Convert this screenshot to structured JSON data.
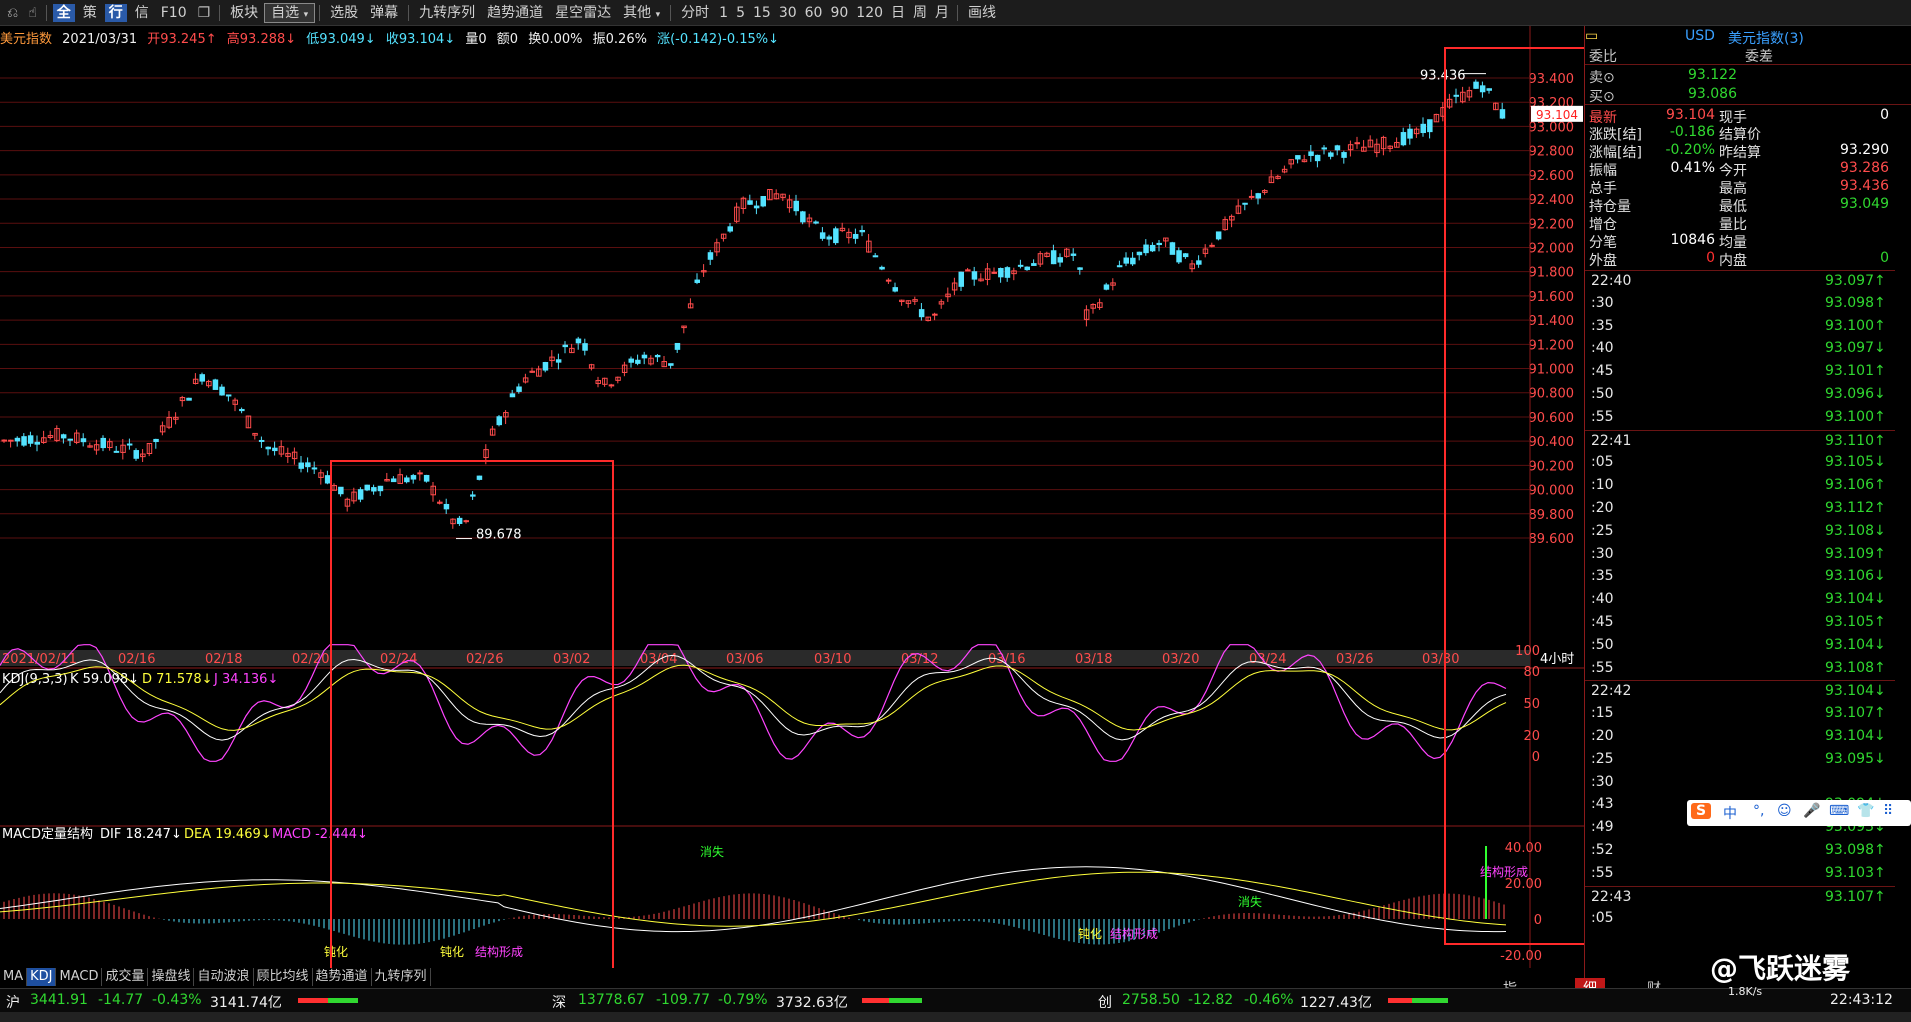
{
  "toolbar": {
    "icons": [
      "back-icon",
      "hand-icon"
    ],
    "items": [
      "全",
      "策",
      "行",
      "信",
      "F10",
      "板块",
      "自选",
      "选股",
      "弹幕",
      "九转序列",
      "趋势通道",
      "星空雷达",
      "其他",
      "分时",
      "1",
      "5",
      "15",
      "30",
      "60",
      "90",
      "120",
      "日",
      "周",
      "月",
      "画线"
    ]
  },
  "info": {
    "name": "美元指数",
    "date": "2021/03/31",
    "open": "开93.245↑",
    "high": "高93.288↓",
    "low": "低93.049↓",
    "close": "收93.104↓",
    "vol": "量0",
    "amount": "额0",
    "turnover": "换0.00%",
    "amplitude": "振0.26%",
    "change": "涨(-0.142)-0.15%↓"
  },
  "main_chart": {
    "price_labels": [
      "93.400",
      "93.200",
      "93.000",
      "92.800",
      "92.600",
      "92.400",
      "92.200",
      "92.000",
      "91.800",
      "91.600",
      "91.400",
      "91.200",
      "91.000",
      "90.800",
      "90.600",
      "90.400",
      "90.200",
      "90.000",
      "89.800",
      "89.600"
    ],
    "price_values": [
      93.4,
      93.2,
      93.0,
      92.8,
      92.6,
      92.4,
      92.2,
      92.0,
      91.8,
      91.6,
      91.4,
      91.2,
      91.0,
      90.8,
      90.6,
      90.4,
      90.2,
      90.0,
      89.8,
      89.6
    ],
    "current_price_tag": "93.104",
    "high_annotation": "93.436",
    "low_annotation": "89.678",
    "date_labels": [
      "2021/02/11",
      "02/16",
      "02/18",
      "02/20",
      "02/24",
      "02/26",
      "03/02",
      "03/04",
      "03/06",
      "03/10",
      "03/12",
      "03/16",
      "03/18",
      "03/20",
      "03/24",
      "03/26",
      "03/30"
    ],
    "period_label": "4小时"
  },
  "kdj": {
    "title": "KDJ(9,3,3)",
    "k": "K 59.098↓",
    "d": "D 71.578↓",
    "j": "J 34.136↓",
    "axis": [
      "100",
      "80",
      "50",
      "20",
      "0"
    ]
  },
  "macd": {
    "title": "MACD定量结构",
    "dif": "DIF 18.247↓",
    "dea": "DEA 19.469↓",
    "macd": "MACD -2.444↓",
    "axis": [
      "40.00",
      "20.00",
      "0",
      "-20.00"
    ],
    "annotations": [
      "消失",
      "钝化",
      "钝化",
      "结构形成",
      "钝化",
      "结构形成",
      "消失",
      "结构形成"
    ]
  },
  "quote_panel": {
    "symbol_prefix": "USD",
    "symbol_name": "美元指数(3)",
    "ratio_label": "委比",
    "diff_label": "委差",
    "sell_label": "卖⊙",
    "sell_value": "93.122",
    "buy_label": "买⊙",
    "buy_value": "93.086",
    "rows": [
      {
        "l1": "最新",
        "v1": "93.104",
        "l2": "现手",
        "v2": "0"
      },
      {
        "l1": "涨跌[结]",
        "v1": "-0.186",
        "l2": "结算价",
        "v2": ""
      },
      {
        "l1": "涨幅[结]",
        "v1": "-0.20%",
        "l2": "昨结算",
        "v2": "93.290"
      },
      {
        "l1": "振幅",
        "v1": "0.41%",
        "l2": "今开",
        "v2": "93.286"
      },
      {
        "l1": "总手",
        "v1": "",
        "l2": "最高",
        "v2": "93.436"
      },
      {
        "l1": "持仓量",
        "v1": "",
        "l2": "最低",
        "v2": "93.049"
      },
      {
        "l1": "增仓",
        "v1": "",
        "l2": "量比",
        "v2": ""
      },
      {
        "l1": "分笔",
        "v1": "10846",
        "l2": "均量",
        "v2": ""
      },
      {
        "l1": "外盘",
        "v1": "0",
        "l2": "内盘",
        "v2": "0"
      }
    ],
    "ticks": [
      {
        "t": "22:40",
        "p": "93.097↑"
      },
      {
        "t": ":30",
        "p": "93.098↑"
      },
      {
        "t": ":35",
        "p": "93.100↑"
      },
      {
        "t": ":40",
        "p": "93.097↓"
      },
      {
        "t": ":45",
        "p": "93.101↑"
      },
      {
        "t": ":50",
        "p": "93.096↓"
      },
      {
        "t": ":55",
        "p": "93.100↑"
      },
      {
        "t": "22:41",
        "p": "93.110↑"
      },
      {
        "t": ":05",
        "p": "93.105↓"
      },
      {
        "t": ":10",
        "p": "93.106↑"
      },
      {
        "t": ":20",
        "p": "93.112↑"
      },
      {
        "t": ":25",
        "p": "93.108↓"
      },
      {
        "t": ":30",
        "p": "93.109↑"
      },
      {
        "t": ":35",
        "p": "93.106↓"
      },
      {
        "t": ":40",
        "p": "93.104↓"
      },
      {
        "t": ":45",
        "p": "93.105↑"
      },
      {
        "t": ":50",
        "p": "93.104↓"
      },
      {
        "t": ":55",
        "p": "93.108↑"
      },
      {
        "t": "22:42",
        "p": "93.104↓"
      },
      {
        "t": ":15",
        "p": "93.107↑"
      },
      {
        "t": ":20",
        "p": "93.104↓"
      },
      {
        "t": ":25",
        "p": "93.095↓"
      },
      {
        "t": ":30",
        "p": ""
      },
      {
        "t": ":43",
        "p": "93.094↓"
      },
      {
        "t": ":49",
        "p": "93.093↓"
      },
      {
        "t": ":52",
        "p": "93.098↑"
      },
      {
        "t": ":55",
        "p": "93.103↑"
      },
      {
        "t": "22:43",
        "p": "93.107↑"
      },
      {
        "t": ":05",
        "p": ""
      }
    ],
    "bottom_tabs": [
      "指",
      "细",
      "财"
    ]
  },
  "bottom_tabs": [
    "MA",
    "KDJ",
    "MACD",
    "成交量",
    "操盘线",
    "自动波浪",
    "顾比均线",
    "趋势通道",
    "九转序列"
  ],
  "status": {
    "sh_label": "沪",
    "sh_index": "3441.91",
    "sh_change": "-14.77",
    "sh_pct": "-0.43%",
    "sh_amount": "3141.74亿",
    "sz_label": "深",
    "sz_index": "13778.67",
    "sz_change": "-109.77",
    "sz_pct": "-0.79%",
    "sz_amount": "3732.63亿",
    "cy_label": "创",
    "cy_index": "2758.50",
    "cy_change": "-12.82",
    "cy_pct": "-0.46%",
    "cy_amount": "1227.43亿",
    "clock": "22:43:12",
    "watermark": "@飞跃迷雾",
    "net_speed": "1.8K/s"
  },
  "ime": {
    "items": [
      "S",
      "中",
      "°,",
      "☺",
      "🎤",
      "⌨",
      "👕",
      "⠿"
    ]
  },
  "colors": {
    "up": "#ff4c4c",
    "down": "#54e3ff",
    "highlight_box": "#ff2a2a",
    "grid": "#5a0f0f"
  }
}
